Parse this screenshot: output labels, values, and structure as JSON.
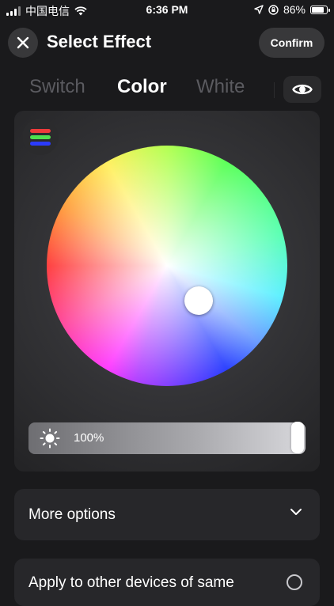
{
  "status_bar": {
    "carrier": "中国电信",
    "time": "6:36 PM",
    "battery": "86%",
    "battery_level": 0.86
  },
  "header": {
    "title": "Select Effect",
    "confirm_label": "Confirm",
    "close_icon": "close-icon"
  },
  "tabs": [
    {
      "label": "Switch",
      "active": false
    },
    {
      "label": "Color",
      "active": true
    },
    {
      "label": "White",
      "active": false
    }
  ],
  "preview_icon": "eye-icon",
  "color_panel": {
    "mode_icon": "rgb-stripes-icon",
    "brightness": "100%",
    "brightness_level": 1.0
  },
  "more_options": {
    "label": "More options",
    "icon": "chevron-down-icon"
  },
  "apply": {
    "label": "Apply to other devices of same"
  }
}
